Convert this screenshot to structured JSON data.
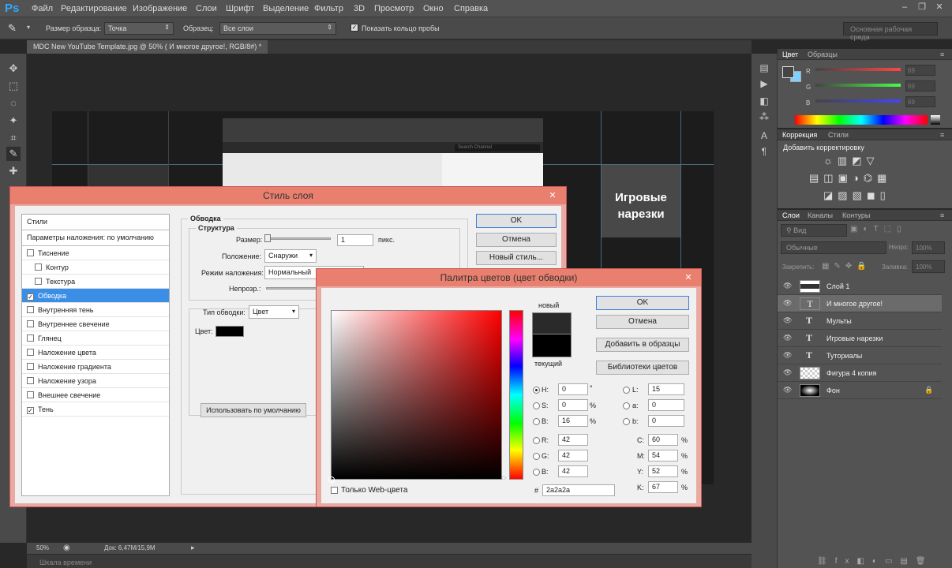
{
  "app": {
    "logo": "Ps"
  },
  "menu": [
    "Файл",
    "Редактирование",
    "Изображение",
    "Слои",
    "Шрифт",
    "Выделение",
    "Фильтр",
    "3D",
    "Просмотр",
    "Окно",
    "Справка"
  ],
  "options": {
    "sample_size_label": "Размер образца:",
    "sample_size_value": "Точка",
    "sample_label": "Образец:",
    "sample_value": "Все слои",
    "show_ring_label": "Показать кольцо пробы",
    "workspace": "Основная рабочая среда"
  },
  "document": {
    "tab_title": "MDC New YouTube Template.jpg @ 50% ( И многое другое!, RGB/8#) *",
    "canvas_text": "Игровые нарезки",
    "search_placeholder": "Search Channel"
  },
  "status": {
    "zoom": "50%",
    "doc_info": "Док: 6,47M/15,9M"
  },
  "timeline_label": "Шкала времени",
  "color_panel": {
    "tabs": [
      "Цвет",
      "Образцы"
    ],
    "channels": [
      {
        "label": "R",
        "value": "69"
      },
      {
        "label": "G",
        "value": "69"
      },
      {
        "label": "B",
        "value": "69"
      }
    ]
  },
  "adjustments_panel": {
    "tabs": [
      "Коррекция",
      "Стили"
    ],
    "title": "Добавить корректировку"
  },
  "layers_panel": {
    "tabs": [
      "Слои",
      "Каналы",
      "Контуры"
    ],
    "kind_filter": "Вид",
    "blend_mode": "Обычные",
    "opacity_label": "Непрз:",
    "opacity_value": "100%",
    "lock_label": "Закрепить:",
    "fill_label": "Заливка:",
    "fill_value": "100%",
    "layers": [
      {
        "name": "Слой 1",
        "type": "image"
      },
      {
        "name": "И многое другое!",
        "type": "text"
      },
      {
        "name": "Мульты",
        "type": "text"
      },
      {
        "name": "Игровые нарезки",
        "type": "text"
      },
      {
        "name": "Туториалы",
        "type": "text"
      },
      {
        "name": "Фигура 4 копия",
        "type": "shape"
      },
      {
        "name": "Фон",
        "type": "background"
      }
    ]
  },
  "layer_style": {
    "title": "Стиль слоя",
    "styles_header": "Стили",
    "blend_defaults": "Параметры наложения: по умолчанию",
    "items": [
      {
        "label": "Тиснение",
        "checked": false
      },
      {
        "label": "Контур",
        "checked": false
      },
      {
        "label": "Текстура",
        "checked": false
      },
      {
        "label": "Обводка",
        "checked": true
      },
      {
        "label": "Внутренняя тень",
        "checked": false
      },
      {
        "label": "Внутреннее свечение",
        "checked": false
      },
      {
        "label": "Глянец",
        "checked": false
      },
      {
        "label": "Наложение цвета",
        "checked": false
      },
      {
        "label": "Наложение градиента",
        "checked": false
      },
      {
        "label": "Наложение узора",
        "checked": false
      },
      {
        "label": "Внешнее свечение",
        "checked": false
      },
      {
        "label": "Тень",
        "checked": true
      }
    ],
    "stroke_group": "Обводка",
    "structure_group": "Структура",
    "size_label": "Размер:",
    "size_value": "1",
    "size_unit": "пикс.",
    "position_label": "Положение:",
    "position_value": "Снаружи",
    "blend_label": "Режим наложения:",
    "blend_value": "Нормальный",
    "opacity_label": "Непрозр.:",
    "fill_type_label": "Тип обводки:",
    "fill_type_value": "Цвет",
    "color_label": "Цвет:",
    "use_default": "Использовать по умолчанию",
    "ok": "OK",
    "cancel": "Отмена",
    "new_style": "Новый стиль..."
  },
  "color_picker": {
    "title": "Палитра цветов (цвет обводки)",
    "new_label": "новый",
    "current_label": "текущий",
    "ok": "OK",
    "cancel": "Отмена",
    "add_swatches": "Добавить в образцы",
    "libraries": "Библиотеки цветов",
    "web_only": "Только Web-цвета",
    "H": "0",
    "S": "0",
    "B": "16",
    "R": "42",
    "G": "42",
    "Bv": "42",
    "L": "15",
    "a": "0",
    "b": "0",
    "C": "60",
    "M": "54",
    "Y": "52",
    "K": "67",
    "hex": "2a2a2a",
    "new_color": "#2a2a2a",
    "current_color": "#000000",
    "labels": {
      "H": "H:",
      "S": "S:",
      "B": "B:",
      "R": "R:",
      "G": "G:",
      "Bv": "B:",
      "L": "L:",
      "a": "a:",
      "b": "b:",
      "C": "C:",
      "M": "M:",
      "Y": "Y:",
      "K": "K:",
      "hash": "#",
      "deg": "°",
      "pct": "%"
    }
  }
}
